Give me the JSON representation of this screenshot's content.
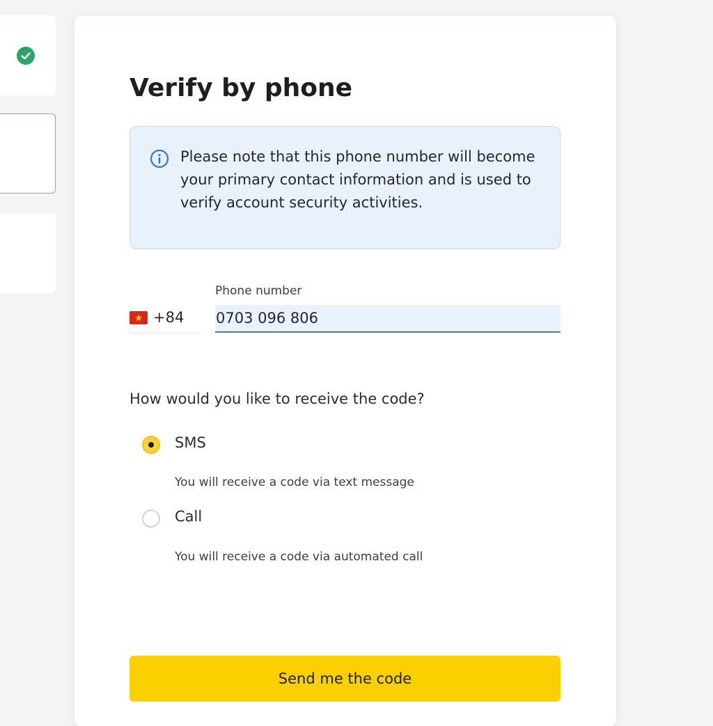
{
  "title": "Verify by phone",
  "notice": {
    "icon": "info-icon",
    "text": "Please note that this phone number will become your primary contact information and is used to verify account security activities."
  },
  "phone": {
    "country_flag": "vietnam-flag-icon",
    "dial_code": "+84",
    "label": "Phone number",
    "value": "0703 096 806"
  },
  "delivery": {
    "question": "How would you like to receive the code?",
    "options": [
      {
        "label": "SMS",
        "description": "You will receive a code via text message",
        "selected": true
      },
      {
        "label": "Call",
        "description": "You will receive a code via automated call",
        "selected": false
      }
    ]
  },
  "submit_label": "Send me the code",
  "colors": {
    "accent": "#fcd000",
    "radio_selected": "#fcd535",
    "notice_bg": "#e9f1fd",
    "success": "#2ea26b",
    "info": "#3b6fd4"
  }
}
